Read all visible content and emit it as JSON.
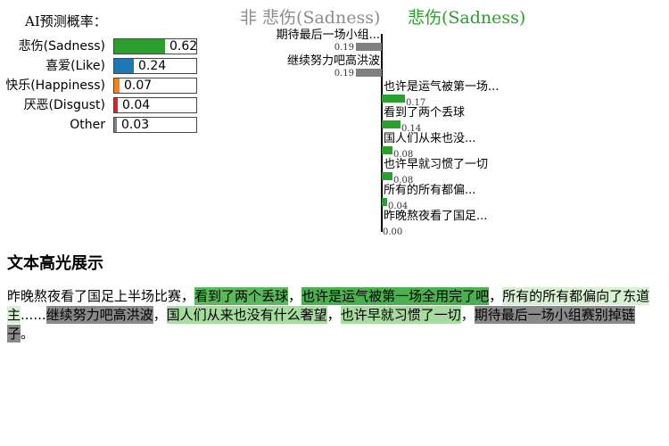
{
  "probability_panel": {
    "title": "AI预测概率：",
    "items": [
      {
        "label": "悲伤(Sadness)",
        "value": 0.62,
        "value_text": "0.62",
        "color": "#2ca02c"
      },
      {
        "label": "喜爱(Like)",
        "value": 0.24,
        "value_text": "0.24",
        "color": "#1f77b4"
      },
      {
        "label": "快乐(Happiness)",
        "value": 0.07,
        "value_text": "0.07",
        "color": "#ff7f0e"
      },
      {
        "label": "厌恶(Disgust)",
        "value": 0.04,
        "value_text": "0.04",
        "color": "#d62728"
      },
      {
        "label": "Other",
        "value": 0.03,
        "value_text": "0.03",
        "color": "#7f7f7f"
      }
    ]
  },
  "contribution_chart": {
    "negative_heading": "非 悲伤(Sadness)",
    "positive_heading": "悲伤(Sadness)",
    "negative_color": "#808080",
    "positive_color": "#2ca02c",
    "max_value": 0.19,
    "features": [
      {
        "label": "期待最后一场小组...",
        "value": 0.19,
        "value_text": "0.19",
        "direction": "negative"
      },
      {
        "label": "继续努力吧高洪波",
        "value": 0.19,
        "value_text": "0.19",
        "direction": "negative"
      },
      {
        "label": "也许是运气被第一场...",
        "value": 0.17,
        "value_text": "0.17",
        "direction": "positive"
      },
      {
        "label": "看到了两个丢球",
        "value": 0.14,
        "value_text": "0.14",
        "direction": "positive"
      },
      {
        "label": "国人们从来也没...",
        "value": 0.08,
        "value_text": "0.08",
        "direction": "positive"
      },
      {
        "label": "也许早就习惯了一切",
        "value": 0.08,
        "value_text": "0.08",
        "direction": "positive"
      },
      {
        "label": "所有的所有都偏...",
        "value": 0.04,
        "value_text": "0.04",
        "direction": "positive"
      },
      {
        "label": "昨晚熬夜看了国足...",
        "value": 0.0,
        "value_text": "0.00",
        "direction": "positive"
      }
    ]
  },
  "highlight_section": {
    "title": "文本高光展示",
    "segments": [
      {
        "text": "昨晚熬夜看了国足上半场比赛",
        "bg": ""
      },
      {
        "text": "，",
        "bg": ""
      },
      {
        "text": "看到了两个丢球",
        "bg": "#5cb85c"
      },
      {
        "text": "，",
        "bg": ""
      },
      {
        "text": "也许是运气被第一场全用完了吧",
        "bg": "#4caf50"
      },
      {
        "text": "，",
        "bg": ""
      },
      {
        "text": "所有的所有都偏向了东道主",
        "bg": "#d9f0d3"
      },
      {
        "text": "......",
        "bg": ""
      },
      {
        "text": "继续努力吧高洪波",
        "bg": "#8a8a8a"
      },
      {
        "text": "，",
        "bg": ""
      },
      {
        "text": "国人们从来也没有什么奢望",
        "bg": "#a8dba0"
      },
      {
        "text": "，",
        "bg": ""
      },
      {
        "text": "也许早就习惯了一切",
        "bg": "#a8dba0"
      },
      {
        "text": "，",
        "bg": ""
      },
      {
        "text": "期待最后一场小组赛别掉链子",
        "bg": "#8a8a8a"
      },
      {
        "text": "。",
        "bg": ""
      }
    ]
  }
}
